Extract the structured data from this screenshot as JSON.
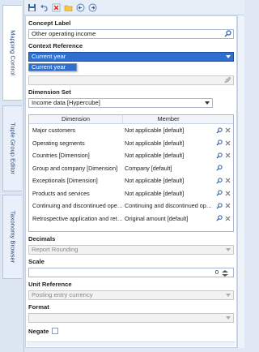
{
  "tabs": [
    {
      "label": "Mapping Control"
    },
    {
      "label": "Tuple Group Editor"
    },
    {
      "label": "Taxonomy Browser"
    }
  ],
  "toolbar": {
    "icons": [
      "save-icon",
      "undo-icon",
      "delete-icon",
      "folder-icon",
      "back-icon",
      "forward-icon"
    ]
  },
  "concept_label": {
    "label": "Concept Label",
    "value": "Other operating income"
  },
  "context_reference": {
    "label": "Context Reference",
    "value": "Current year",
    "dropdown_options": [
      "Current year"
    ]
  },
  "dimension_set": {
    "label": "Dimension Set",
    "value": "Income data [Hypercube]"
  },
  "dimension_table": {
    "headers": {
      "dimension": "Dimension",
      "member": "Member"
    },
    "rows": [
      {
        "dimension": "Major customers",
        "member": "Not applicable [default]",
        "has_delete": true
      },
      {
        "dimension": "Operating segments",
        "member": "Not applicable [default]",
        "has_delete": true
      },
      {
        "dimension": "Countries [Dimension]",
        "member": "Not applicable [default]",
        "has_delete": true
      },
      {
        "dimension": "Group and company [Dimension]",
        "member": "Company [default]",
        "has_delete": false
      },
      {
        "dimension": "Exceptionals [Dimension]",
        "member": "Not applicable [default]",
        "has_delete": true
      },
      {
        "dimension": "Products and services",
        "member": "Not applicable [default]",
        "has_delete": true
      },
      {
        "dimension": "Continuing and discontinued operat...",
        "member": "Continuing and discontinued operat...",
        "has_delete": true
      },
      {
        "dimension": "Retrospective application and retros...",
        "member": "Original amount [default]",
        "has_delete": true
      }
    ]
  },
  "decimals": {
    "label": "Decimals",
    "value": "Report Rounding"
  },
  "scale": {
    "label": "Scale",
    "value": "0"
  },
  "unit_reference": {
    "label": "Unit Reference",
    "value": "Posting entry currency"
  },
  "format": {
    "label": "Format",
    "value": ""
  },
  "negate": {
    "label": "Negate",
    "checked": false
  },
  "colors": {
    "accent": "#2f6fd0",
    "panel_bg": "#dfe8f3",
    "tab_text": "#2c4a75"
  }
}
